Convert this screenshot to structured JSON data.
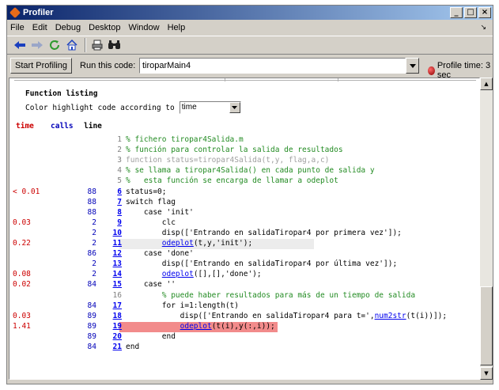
{
  "window": {
    "title": "Profiler",
    "minimize": "_",
    "maximize": "□",
    "close": "×"
  },
  "menu": {
    "items": [
      "File",
      "Edit",
      "Debug",
      "Desktop",
      "Window",
      "Help"
    ],
    "close_glyph": "✕"
  },
  "toolbar": {
    "icons": [
      "back-arrow-icon",
      "forward-arrow-icon",
      "refresh-icon",
      "home-icon",
      "print-icon",
      "find-icon"
    ]
  },
  "runbar": {
    "start_button": "Start Profiling",
    "run_label": "Run this code:",
    "run_value": "tiroparMain4",
    "profile_time": "Profile time: 3 sec"
  },
  "listing": {
    "heading": "Function listing",
    "highlight_label": "Color highlight code according to",
    "highlight_value": "time",
    "col_time": "time",
    "col_calls": "calls",
    "col_line": "line",
    "rows": [
      {
        "time": "",
        "calls": "",
        "line": "1",
        "link": false,
        "kind": "comment",
        "code": "% fichero tiropar4Salida.m",
        "hl": ""
      },
      {
        "time": "",
        "calls": "",
        "line": "2",
        "link": false,
        "kind": "comment",
        "code": "% función para controlar la salida de resultados",
        "hl": ""
      },
      {
        "time": "",
        "calls": "",
        "line": "3",
        "link": false,
        "kind": "gray",
        "code": "function status=tiropar4Salida(t,y, flag,a,c)",
        "hl": ""
      },
      {
        "time": "",
        "calls": "",
        "line": "4",
        "link": false,
        "kind": "comment",
        "code": "% se llama a tiropar4Salida() en cada punto de salida y",
        "hl": ""
      },
      {
        "time": "",
        "calls": "",
        "line": "5",
        "link": false,
        "kind": "comment",
        "code": "%   esta función se encarga de llamar a odeplot",
        "hl": ""
      },
      {
        "time": "< 0.01",
        "calls": "88",
        "line": "6",
        "link": true,
        "kind": "code",
        "code": "status=0;",
        "hl": ""
      },
      {
        "time": "",
        "calls": "88",
        "line": "7",
        "link": true,
        "kind": "code",
        "code": "switch flag",
        "hl": ""
      },
      {
        "time": "",
        "calls": "88",
        "line": "8",
        "link": true,
        "kind": "code",
        "code": "    case 'init'",
        "hl": ""
      },
      {
        "time": "0.03",
        "calls": "2",
        "line": "9",
        "link": true,
        "kind": "code",
        "code": "        clc",
        "hl": ""
      },
      {
        "time": "",
        "calls": "2",
        "line": "10",
        "link": true,
        "kind": "code",
        "code": "        disp(['Entrando en salidaTiropar4 por primera vez']);",
        "hl": ""
      },
      {
        "time": "0.22",
        "calls": "2",
        "line": "11",
        "link": true,
        "kind": "code",
        "code": "        ",
        "fn": "odeplot",
        "rest": "(t,y,'init');",
        "hl": "#ececec"
      },
      {
        "time": "",
        "calls": "86",
        "line": "12",
        "link": true,
        "kind": "code",
        "code": "    case 'done'",
        "hl": ""
      },
      {
        "time": "",
        "calls": "2",
        "line": "13",
        "link": true,
        "kind": "code",
        "code": "        disp(['Entrando en salidaTiropar4 por última vez']);",
        "hl": ""
      },
      {
        "time": "0.08",
        "calls": "2",
        "line": "14",
        "link": true,
        "kind": "code",
        "code": "        ",
        "fn": "odeplot",
        "rest": "([],[],'done');",
        "hl": ""
      },
      {
        "time": "0.02",
        "calls": "84",
        "line": "15",
        "link": true,
        "kind": "code",
        "code": "    case ''",
        "hl": ""
      },
      {
        "time": "",
        "calls": "",
        "line": "16",
        "link": false,
        "kind": "comment",
        "code": "        % puede haber resultados para más de un tiempo de salida",
        "hl": ""
      },
      {
        "time": "",
        "calls": "84",
        "line": "17",
        "link": true,
        "kind": "code",
        "code": "        for i=1:length(t)",
        "hl": ""
      },
      {
        "time": "0.03",
        "calls": "89",
        "line": "18",
        "link": true,
        "kind": "code",
        "code": "            disp(['Entrando en salidaTiropar4 para t=',",
        "fn": "num2str",
        "rest": "(t(i))]);",
        "hl": ""
      },
      {
        "time": "1.41",
        "calls": "89",
        "line": "19",
        "link": true,
        "kind": "code",
        "code": "            ",
        "fn": "odeplot",
        "rest": "(t(i),y(:,i));",
        "hl": "#f28b8b"
      },
      {
        "time": "",
        "calls": "89",
        "line": "20",
        "link": true,
        "kind": "code",
        "code": "        end",
        "hl": ""
      },
      {
        "time": "",
        "calls": "84",
        "line": "21",
        "link": true,
        "kind": "code",
        "code": "end",
        "hl": ""
      }
    ]
  }
}
